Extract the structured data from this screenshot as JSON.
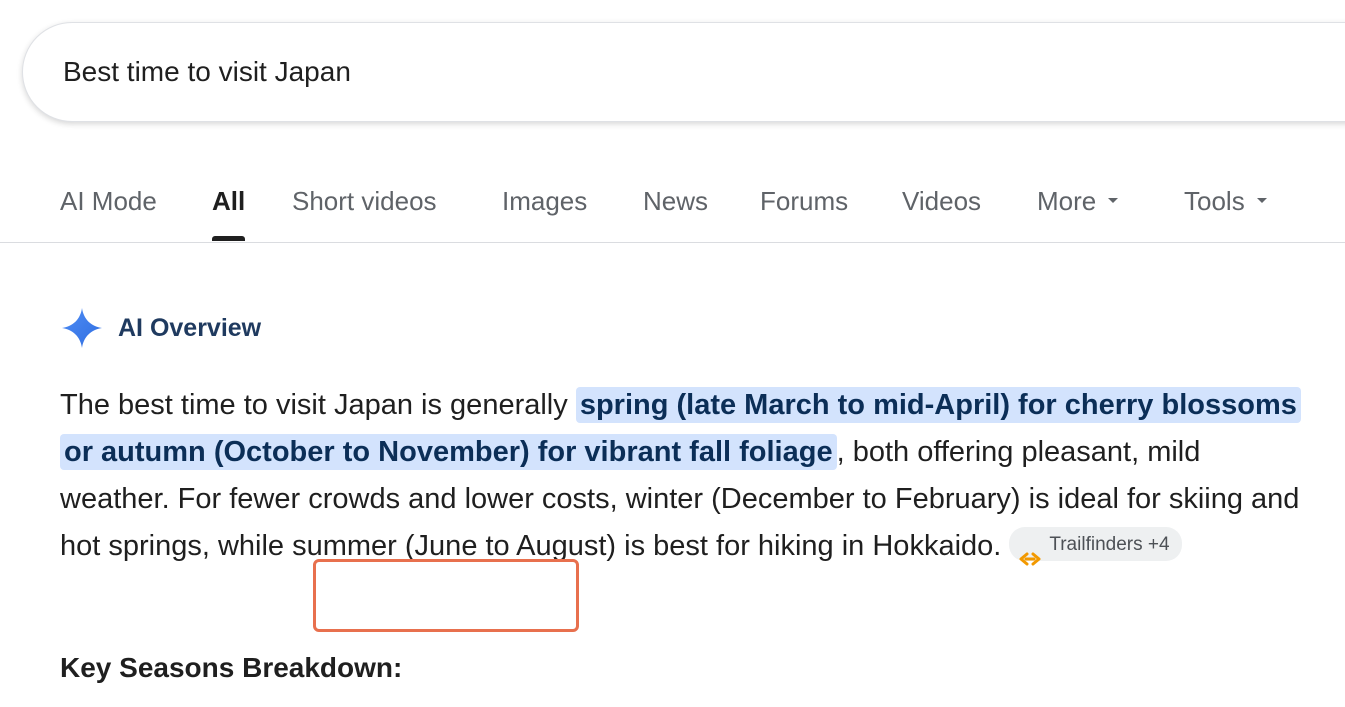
{
  "search": {
    "query": "Best time to visit Japan"
  },
  "tabs": [
    {
      "label": "AI Mode",
      "active": false
    },
    {
      "label": "All",
      "active": true
    },
    {
      "label": "Short videos",
      "active": false
    },
    {
      "label": "Images",
      "active": false
    },
    {
      "label": "News",
      "active": false
    },
    {
      "label": "Forums",
      "active": false
    },
    {
      "label": "Videos",
      "active": false
    },
    {
      "label": "More",
      "active": false,
      "dropdown": true
    },
    {
      "label": "Tools",
      "active": false,
      "dropdown": true
    }
  ],
  "ai_overview": {
    "title": "AI Overview",
    "icon": "sparkle-icon",
    "accent_color": "#4285f4",
    "text_before": "The best time to visit Japan is generally ",
    "highlight": "spring (late March to mid-April) for cherry blossoms or autumn (October to November) for vibrant fall foliage",
    "text_after": ", both offering pleasant, mild weather. For fewer crowds and lower costs, winter (December to February) is ideal for skiing and hot springs, while summer (June to August) is best for hiking in Hokkaido.",
    "source_chip": {
      "label": "Trailfinders +4",
      "icon": "link-icon",
      "icon_color": "#f29900"
    }
  },
  "annotation": {
    "color": "#e8704e"
  },
  "section": {
    "heading": "Key Seasons Breakdown:"
  }
}
